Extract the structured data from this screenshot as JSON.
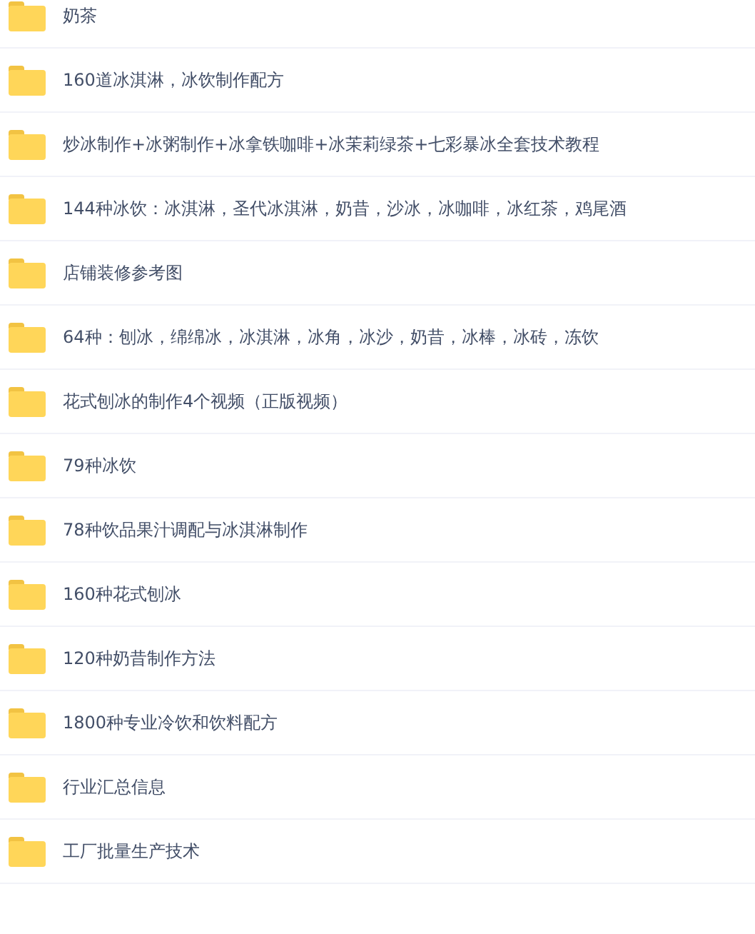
{
  "folders": [
    {
      "name": "奶茶"
    },
    {
      "name": "160道冰淇淋，冰饮制作配方"
    },
    {
      "name": "炒冰制作+冰粥制作+冰拿铁咖啡+冰茉莉绿茶+七彩暴冰全套技术教程"
    },
    {
      "name": "144种冰饮：冰淇淋，圣代冰淇淋，奶昔，沙冰，冰咖啡，冰红茶，鸡尾酒"
    },
    {
      "name": "店铺装修参考图"
    },
    {
      "name": "64种：刨冰，绵绵冰，冰淇淋，冰角，冰沙，奶昔，冰棒，冰砖，冻饮"
    },
    {
      "name": "花式刨冰的制作4个视频（正版视频）"
    },
    {
      "name": "79种冰饮"
    },
    {
      "name": "78种饮品果汁调配与冰淇淋制作"
    },
    {
      "name": "160种花式刨冰"
    },
    {
      "name": "120种奶昔制作方法"
    },
    {
      "name": "1800种专业冷饮和饮料配方"
    },
    {
      "name": "行业汇总信息"
    },
    {
      "name": "工厂批量生产技术"
    }
  ]
}
